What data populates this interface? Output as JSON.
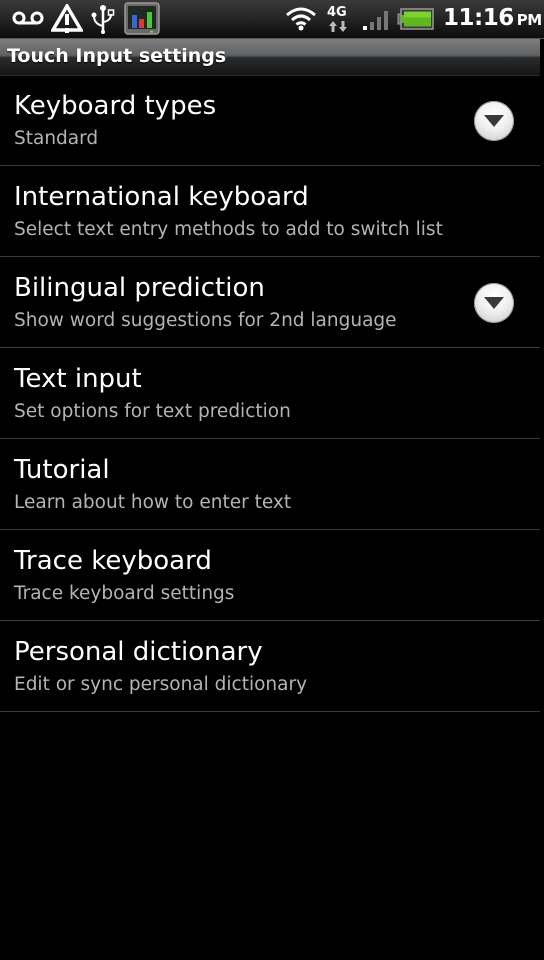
{
  "status_bar": {
    "icons": [
      "voicemail-icon",
      "alert-icon",
      "usb-icon",
      "app-monitor-icon",
      "wifi-icon",
      "4g-icon",
      "signal-icon",
      "battery-icon"
    ],
    "network_label": "4G",
    "time": "11:16",
    "ampm": "PM",
    "battery_color": "#5fb81e",
    "app_bar_colors": [
      "#3a64d8",
      "#d83a3a",
      "#4fc43a"
    ]
  },
  "header": {
    "title": "Touch Input settings"
  },
  "settings": {
    "items": [
      {
        "label": "Keyboard types",
        "summary": "Standard",
        "has_dropdown": true
      },
      {
        "label": "International keyboard",
        "summary": "Select text entry methods to add to switch list",
        "has_dropdown": false
      },
      {
        "label": "Bilingual prediction",
        "summary": "Show word suggestions for 2nd language",
        "has_dropdown": true
      },
      {
        "label": "Text input",
        "summary": "Set options for text prediction",
        "has_dropdown": false
      },
      {
        "label": "Tutorial",
        "summary": "Learn about how to enter text",
        "has_dropdown": false
      },
      {
        "label": "Trace keyboard",
        "summary": "Trace keyboard settings",
        "has_dropdown": false
      },
      {
        "label": "Personal dictionary",
        "summary": "Edit or sync personal dictionary",
        "has_dropdown": false
      }
    ]
  }
}
